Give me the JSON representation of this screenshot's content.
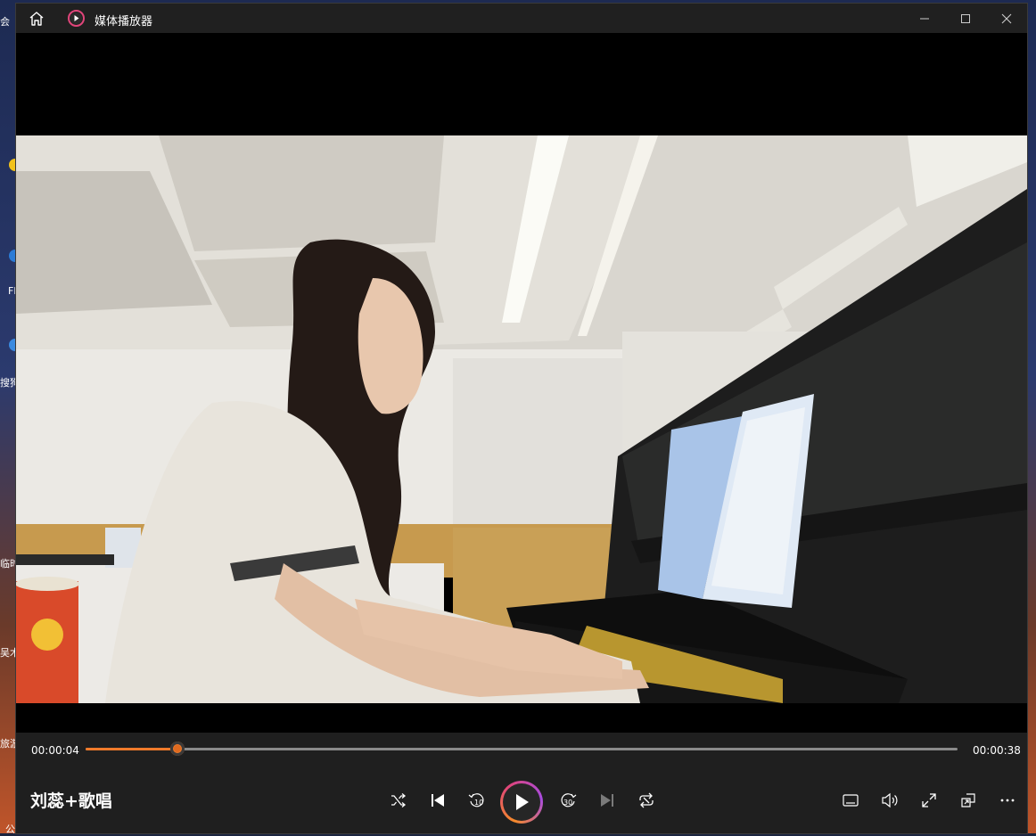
{
  "window": {
    "title": "媒体播放器"
  },
  "playback": {
    "current_time": "00:00:04",
    "total_time": "00:00:38",
    "progress_fraction": 0.105
  },
  "now_playing": {
    "title": "刘蕊+歌唱"
  },
  "desktop": {
    "labels": [
      "会",
      "Fl",
      "搜狗",
      "临时",
      "吴木",
      "旅游",
      "公"
    ]
  },
  "colors": {
    "accent": "#f07a2a",
    "titlebar": "#202020",
    "controls_bg": "#1f1f1f"
  },
  "icons": {
    "home": "home-icon",
    "app": "media-player-icon",
    "minimize": "minimize-icon",
    "maximize": "maximize-icon",
    "close": "close-icon",
    "shuffle": "shuffle-icon",
    "previous": "previous-track-icon",
    "back10": "rewind-10-icon",
    "play": "play-icon",
    "forward30": "forward-30-icon",
    "next": "next-track-icon",
    "repeat": "repeat-icon",
    "subtitles": "subtitles-icon",
    "volume": "volume-icon",
    "fullscreen": "fullscreen-icon",
    "miniplayer": "mini-player-icon",
    "more": "more-options-icon"
  }
}
